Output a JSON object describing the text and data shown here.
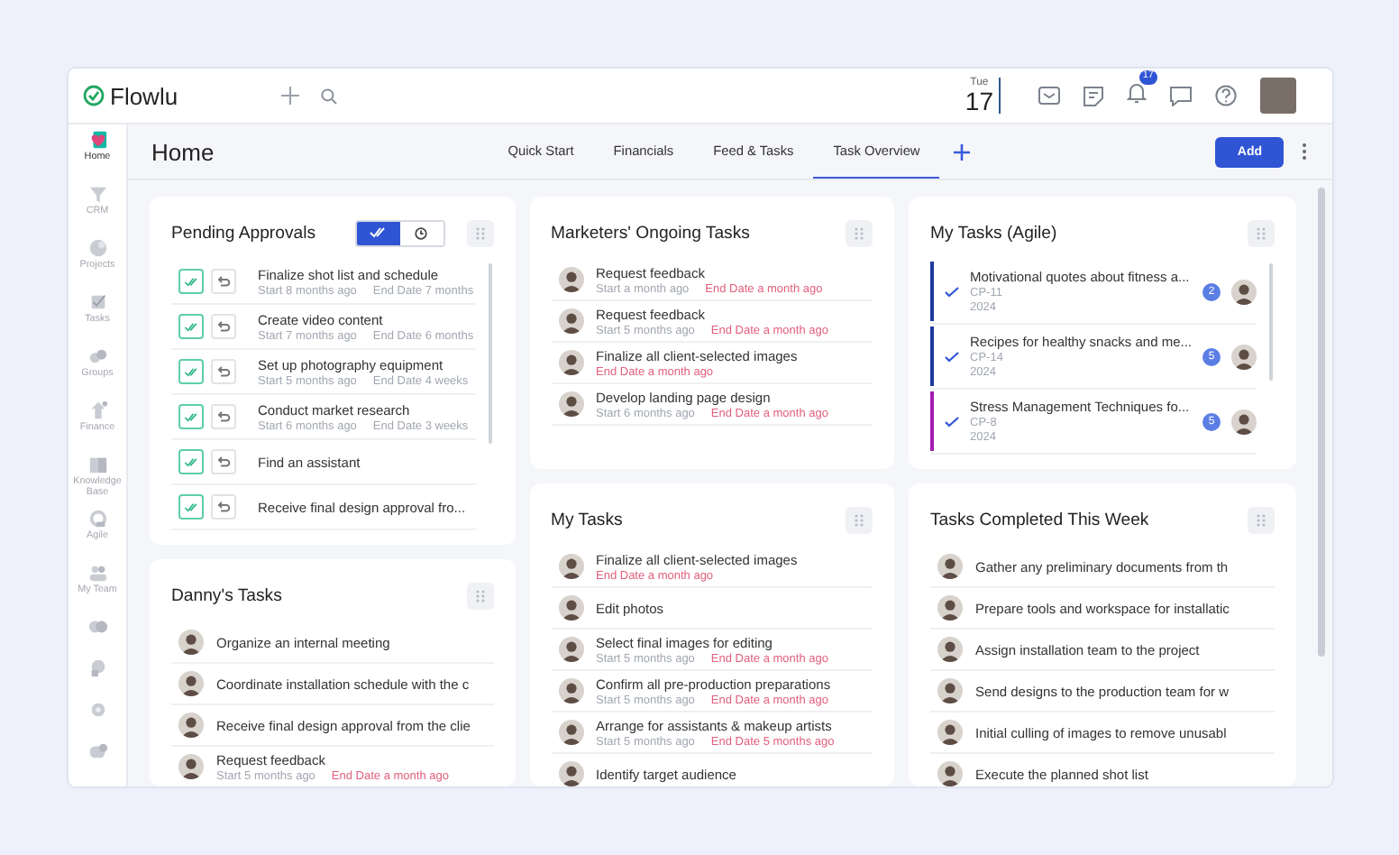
{
  "app": {
    "name": "Flowlu",
    "date_day": "Tue",
    "date_num": "17",
    "notifications": "17"
  },
  "sidebar": {
    "items": [
      {
        "label": "Home",
        "selected": true
      },
      {
        "label": "CRM",
        "selected": false
      },
      {
        "label": "Projects",
        "selected": false
      },
      {
        "label": "Tasks",
        "selected": false
      },
      {
        "label": "Groups",
        "selected": false
      },
      {
        "label": "Finance",
        "selected": false
      },
      {
        "label": "Knowledge Base",
        "selected": false
      },
      {
        "label": "Agile",
        "selected": false
      },
      {
        "label": "My Team",
        "selected": false
      },
      {
        "selected": false
      },
      {
        "selected": false
      },
      {
        "selected": false
      },
      {
        "selected": false
      }
    ]
  },
  "page": {
    "title": "Home",
    "add_button": "Add"
  },
  "tabs": [
    {
      "label": "Quick Start",
      "selected": false
    },
    {
      "label": "Financials",
      "selected": false
    },
    {
      "label": "Feed & Tasks",
      "selected": false
    },
    {
      "label": "Task Overview",
      "selected": true
    }
  ],
  "pending_approvals": {
    "title": "Pending Approvals",
    "toggle": [
      {
        "kind": "approved",
        "selected": true
      },
      {
        "kind": "history",
        "selected": false
      }
    ],
    "items": [
      {
        "title": "Finalize shot list and schedule",
        "start": "Start 8 months ago",
        "end": "End Date 7 months",
        "overdue": false
      },
      {
        "title": "Create video content",
        "start": "Start 7 months ago",
        "end": "End Date 6 months",
        "overdue": false
      },
      {
        "title": "Set up photography equipment",
        "start": "Start 5 months ago",
        "end": "End Date 4 weeks",
        "overdue": false
      },
      {
        "title": "Conduct market research",
        "start": "Start 6 months ago",
        "end": "End Date 3 weeks",
        "overdue": false
      },
      {
        "title": "Find an assistant"
      },
      {
        "title": "Receive final design approval fro..."
      }
    ]
  },
  "dannys_tasks": {
    "title": "Danny's Tasks",
    "items": [
      {
        "title": "Organize an internal meeting"
      },
      {
        "title": "Coordinate installation schedule with the c"
      },
      {
        "title": "Receive final design approval from the clie"
      },
      {
        "title": "Request feedback",
        "start": "Start 5 months ago",
        "end": "End Date a month ago",
        "overdue": true
      }
    ]
  },
  "marketers_tasks": {
    "title": "Marketers' Ongoing Tasks",
    "items": [
      {
        "title": "Request feedback",
        "start": "Start a month ago",
        "end": "End Date a month ago",
        "overdue": true
      },
      {
        "title": "Request feedback",
        "start": "Start 5 months ago",
        "end": "End Date a month ago",
        "overdue": true
      },
      {
        "title": "Finalize all client-selected images",
        "end": "End Date a month ago",
        "overdue": true
      },
      {
        "title": "Develop landing page design",
        "start": "Start 6 months ago",
        "end": "End Date a month ago",
        "overdue": true
      }
    ]
  },
  "my_tasks": {
    "title": "My Tasks",
    "items": [
      {
        "title": "Finalize all client-selected images",
        "end": "End Date a month ago",
        "overdue": true
      },
      {
        "title": "Edit photos"
      },
      {
        "title": "Select final images for editing",
        "start": "Start 5 months ago",
        "end": "End Date a month ago",
        "overdue": true
      },
      {
        "title": "Confirm all pre-production preparations",
        "start": "Start 5 months ago",
        "end": "End Date a month ago",
        "overdue": true
      },
      {
        "title": "Arrange for assistants & makeup artists",
        "start": "Start 5 months ago",
        "end": "End Date 5 months ago",
        "overdue": true
      },
      {
        "title": "Identify target audience"
      }
    ]
  },
  "agile_tasks": {
    "title": "My Tasks (Agile)",
    "items": [
      {
        "title": "Motivational quotes about fitness a...",
        "code": "CP-11",
        "year": "2024",
        "count": "2",
        "color": "#1e3a9e"
      },
      {
        "title": "Recipes for healthy snacks and me...",
        "code": "CP-14",
        "year": "2024",
        "count": "5",
        "color": "#1e3a9e"
      },
      {
        "title": "Stress Management Techniques fo...",
        "code": "CP-8",
        "year": "2024",
        "count": "5",
        "color": "#a21caf"
      }
    ]
  },
  "completed_tasks": {
    "title": "Tasks Completed This Week",
    "items": [
      {
        "title": "Gather any preliminary documents from th"
      },
      {
        "title": "Prepare tools and workspace for installatic"
      },
      {
        "title": "Assign installation team to the project"
      },
      {
        "title": "Send designs to the production team for w"
      },
      {
        "title": "Initial culling of images to remove unusabl"
      },
      {
        "title": "Execute the planned shot list"
      }
    ]
  }
}
